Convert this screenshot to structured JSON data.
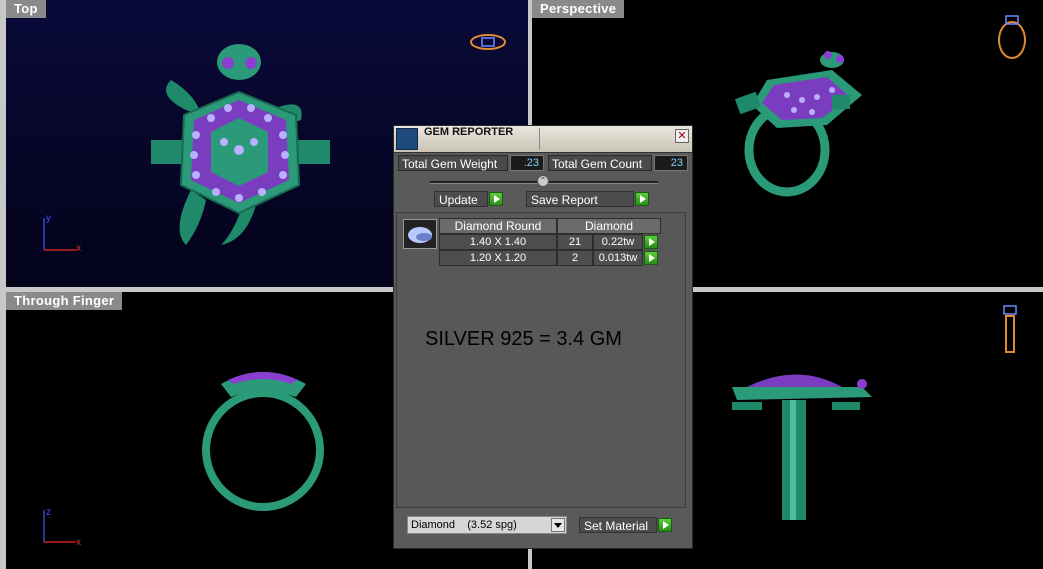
{
  "viewports": {
    "top": {
      "label": "Top",
      "axis_v": "y",
      "axis_h": "x"
    },
    "perspective": {
      "label": "Perspective"
    },
    "through_finger": {
      "label": "Through Finger",
      "axis_v": "z",
      "axis_h": "x"
    }
  },
  "gem_reporter": {
    "title": "GEM REPORTER",
    "close_glyph": "✕",
    "total_gem_weight_label": "Total Gem Weight",
    "total_gem_weight_value": ".23",
    "total_gem_count_label": "Total Gem Count",
    "total_gem_count_value": "23",
    "slider_glyph": "⌃",
    "update_label": "Update",
    "save_report_label": "Save Report",
    "table": {
      "headers": [
        "Diamond Round",
        "Diamond"
      ],
      "rows": [
        {
          "size": "1.40 X 1.40",
          "count": "21",
          "weight": "0.22tw"
        },
        {
          "size": "1.20 X 1.20",
          "count": "2",
          "weight": "0.013tw"
        }
      ]
    },
    "material_note": "SILVER 925 = 3.4 GM",
    "material_dropdown": "Diamond    (3.52 spg)",
    "set_material_label": "Set Material"
  },
  "colors": {
    "model_green": "#2a9a78",
    "gem_purple": "#8a3fd0",
    "axis_red": "#cc2222",
    "axis_blue": "#3344cc",
    "ring_icon": "#e08a30"
  },
  "icons": {
    "gem_reporter_app": "gem-report-icon",
    "ring_orientation_top": "ring-orientation-icon",
    "ring_orientation_perspective": "ring-orientation-icon",
    "ring_orientation_front": "ring-orientation-icon"
  }
}
